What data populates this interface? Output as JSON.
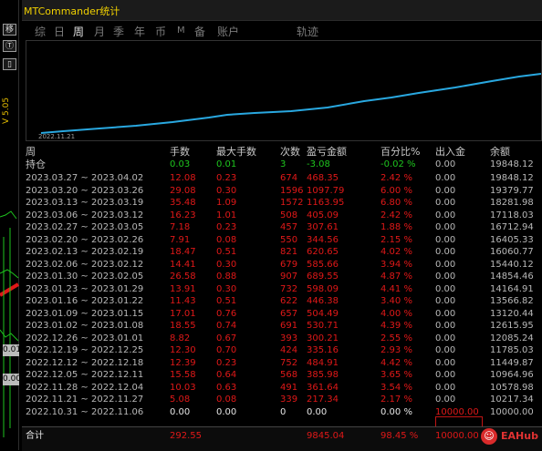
{
  "window": {
    "title": "MTCommander统计"
  },
  "side": {
    "buttons": [
      "移",
      "Ⓣ",
      "▯",
      "☑"
    ],
    "version": "V 5.05",
    "price1": "0.01",
    "price2": "0.00"
  },
  "tabs": [
    {
      "label": "综",
      "active": false
    },
    {
      "label": "日",
      "active": false
    },
    {
      "label": "周",
      "active": true
    },
    {
      "label": "月",
      "active": false
    },
    {
      "label": "季",
      "active": false
    },
    {
      "label": "年",
      "active": false
    },
    {
      "label": "币",
      "active": false
    },
    {
      "label": "M",
      "active": false
    },
    {
      "label": "备",
      "active": false
    },
    {
      "label": "账户",
      "active": false
    },
    {
      "label": "轨迹",
      "active": false
    }
  ],
  "chart": {
    "start_date": "2022.11.21",
    "line_color": "#29a8e0"
  },
  "table": {
    "headers": [
      "手数",
      "最大手数",
      "次数",
      "盈亏金额",
      "百分比%",
      "出入金",
      "余额"
    ],
    "period_label": "周",
    "current": {
      "label": "持仓",
      "lots": "0.03",
      "max_lots": "0.01",
      "count": "3",
      "profit": "-3.08",
      "percent": "-0.02 %",
      "deposit": "0.00",
      "balance": "19848.12"
    },
    "rows": [
      {
        "period": "2023.03.27 ~ 2023.04.02",
        "lots": "12.08",
        "max_lots": "0.23",
        "count": "674",
        "profit": "468.35",
        "percent": "2.42 %",
        "deposit": "0.00",
        "balance": "19848.12"
      },
      {
        "period": "2023.03.20 ~ 2023.03.26",
        "lots": "29.08",
        "max_lots": "0.30",
        "count": "1596",
        "profit": "1097.79",
        "percent": "6.00 %",
        "deposit": "0.00",
        "balance": "19379.77"
      },
      {
        "period": "2023.03.13 ~ 2023.03.19",
        "lots": "35.48",
        "max_lots": "1.09",
        "count": "1572",
        "profit": "1163.95",
        "percent": "6.80 %",
        "deposit": "0.00",
        "balance": "18281.98"
      },
      {
        "period": "2023.03.06 ~ 2023.03.12",
        "lots": "16.23",
        "max_lots": "1.01",
        "count": "508",
        "profit": "405.09",
        "percent": "2.42 %",
        "deposit": "0.00",
        "balance": "17118.03"
      },
      {
        "period": "2023.02.27 ~ 2023.03.05",
        "lots": "7.18",
        "max_lots": "0.23",
        "count": "457",
        "profit": "307.61",
        "percent": "1.88 %",
        "deposit": "0.00",
        "balance": "16712.94"
      },
      {
        "period": "2023.02.20 ~ 2023.02.26",
        "lots": "7.91",
        "max_lots": "0.08",
        "count": "550",
        "profit": "344.56",
        "percent": "2.15 %",
        "deposit": "0.00",
        "balance": "16405.33"
      },
      {
        "period": "2023.02.13 ~ 2023.02.19",
        "lots": "18.47",
        "max_lots": "0.51",
        "count": "821",
        "profit": "620.65",
        "percent": "4.02 %",
        "deposit": "0.00",
        "balance": "16060.77"
      },
      {
        "period": "2023.02.06 ~ 2023.02.12",
        "lots": "14.41",
        "max_lots": "0.30",
        "count": "679",
        "profit": "585.66",
        "percent": "3.94 %",
        "deposit": "0.00",
        "balance": "15440.12"
      },
      {
        "period": "2023.01.30 ~ 2023.02.05",
        "lots": "26.58",
        "max_lots": "0.88",
        "count": "907",
        "profit": "689.55",
        "percent": "4.87 %",
        "deposit": "0.00",
        "balance": "14854.46"
      },
      {
        "period": "2023.01.23 ~ 2023.01.29",
        "lots": "13.91",
        "max_lots": "0.30",
        "count": "732",
        "profit": "598.09",
        "percent": "4.41 %",
        "deposit": "0.00",
        "balance": "14164.91"
      },
      {
        "period": "2023.01.16 ~ 2023.01.22",
        "lots": "11.43",
        "max_lots": "0.51",
        "count": "622",
        "profit": "446.38",
        "percent": "3.40 %",
        "deposit": "0.00",
        "balance": "13566.82"
      },
      {
        "period": "2023.01.09 ~ 2023.01.15",
        "lots": "17.01",
        "max_lots": "0.76",
        "count": "657",
        "profit": "504.49",
        "percent": "4.00 %",
        "deposit": "0.00",
        "balance": "13120.44"
      },
      {
        "period": "2023.01.02 ~ 2023.01.08",
        "lots": "18.55",
        "max_lots": "0.74",
        "count": "691",
        "profit": "530.71",
        "percent": "4.39 %",
        "deposit": "0.00",
        "balance": "12615.95"
      },
      {
        "period": "2022.12.26 ~ 2023.01.01",
        "lots": "8.82",
        "max_lots": "0.67",
        "count": "393",
        "profit": "300.21",
        "percent": "2.55 %",
        "deposit": "0.00",
        "balance": "12085.24"
      },
      {
        "period": "2022.12.19 ~ 2022.12.25",
        "lots": "12.30",
        "max_lots": "0.70",
        "count": "424",
        "profit": "335.16",
        "percent": "2.93 %",
        "deposit": "0.00",
        "balance": "11785.03"
      },
      {
        "period": "2022.12.12 ~ 2022.12.18",
        "lots": "12.39",
        "max_lots": "0.23",
        "count": "752",
        "profit": "484.91",
        "percent": "4.42 %",
        "deposit": "0.00",
        "balance": "11449.87"
      },
      {
        "period": "2022.12.05 ~ 2022.12.11",
        "lots": "15.58",
        "max_lots": "0.64",
        "count": "568",
        "profit": "385.98",
        "percent": "3.65 %",
        "deposit": "0.00",
        "balance": "10964.96"
      },
      {
        "period": "2022.11.28 ~ 2022.12.04",
        "lots": "10.03",
        "max_lots": "0.63",
        "count": "491",
        "profit": "361.64",
        "percent": "3.54 %",
        "deposit": "0.00",
        "balance": "10578.98"
      },
      {
        "period": "2022.11.21 ~ 2022.11.27",
        "lots": "5.08",
        "max_lots": "0.08",
        "count": "339",
        "profit": "217.34",
        "percent": "2.17 %",
        "deposit": "0.00",
        "balance": "10217.34"
      },
      {
        "period": "2022.10.31 ~ 2022.11.06",
        "lots": "0.00",
        "max_lots": "0.00",
        "count": "0",
        "profit": "0.00",
        "percent": "0.00 %",
        "deposit": "10000.00",
        "balance": "10000.00"
      }
    ],
    "total": {
      "label": "合计",
      "lots": "292.55",
      "profit": "9845.04",
      "percent": "98.45 %",
      "deposit": "10000.00"
    }
  },
  "watermark": "EAHub",
  "colors": {
    "title": "#f0d000",
    "positive": "#e01818",
    "current": "#1ec51e",
    "curve": "#29a8e0"
  }
}
